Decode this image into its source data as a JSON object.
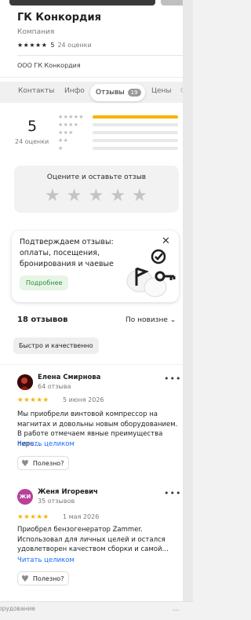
{
  "header": {
    "title": "ГК Конкордия",
    "subtitle": "Компания",
    "stars": "★★★★★",
    "rating": "5",
    "ratings_count": "24 оценки",
    "organization": "ООО ГК Конкордия"
  },
  "tabs": {
    "contacts": "Контакты",
    "info": "Инфо",
    "reviews": "Отзывы",
    "reviews_badge": "19",
    "prices": "Цены",
    "overflow": "О"
  },
  "summary": {
    "rating": "5",
    "count": "24 оценки",
    "distribution": [
      {
        "stars": "★★★★★",
        "share": 1.0
      },
      {
        "stars": "★★★★",
        "share": 0
      },
      {
        "stars": "★★★",
        "share": 0
      },
      {
        "stars": "★★",
        "share": 0
      },
      {
        "stars": "★",
        "share": 0
      }
    ]
  },
  "rate_box": {
    "title": "Оцените и оставьте отзыв",
    "star": "★"
  },
  "promo": {
    "text": "Подтверждаем отзывы: оплаты, посещения, бронирования и чаевые",
    "button": "Подробнее",
    "close": "✕"
  },
  "reviews_header": {
    "count": "18 отзывов",
    "sort": "По новизне",
    "sort_icon": "⌄",
    "tag": "Быстро и качественно"
  },
  "reviews": [
    {
      "name": "Елена Смирнова",
      "count": "64 отзыва",
      "stars": "★★★★★",
      "date": "5 июня 2026",
      "text": "Мы приобрели винтовой компрессор на магнитах и довольны новым оборудованием. В работе отмечаем явные преимущества пере…",
      "link": "Читать целиком",
      "useful": "Полезно?",
      "more": "•••",
      "avatar_color": "#5a1010"
    },
    {
      "name": "Женя Игоревич",
      "count": "35 отзывов",
      "stars": "★★★★★",
      "date": "1 мая 2026",
      "text": "Приобрел бензогенератор Zammer. Использовал для личных целей и остался удовлетворен качеством сборки и самой…",
      "link": "Читать целиком",
      "useful": "Полезно?",
      "more": "•••",
      "avatar_initials": "ЖИ",
      "avatar_color": "#b9409a"
    }
  ],
  "footer": {
    "text": "орудование",
    "more": "..."
  },
  "colors": {
    "accent_star": "#f5b400",
    "link": "#196dff",
    "promo_green": "#2e8b3c"
  }
}
